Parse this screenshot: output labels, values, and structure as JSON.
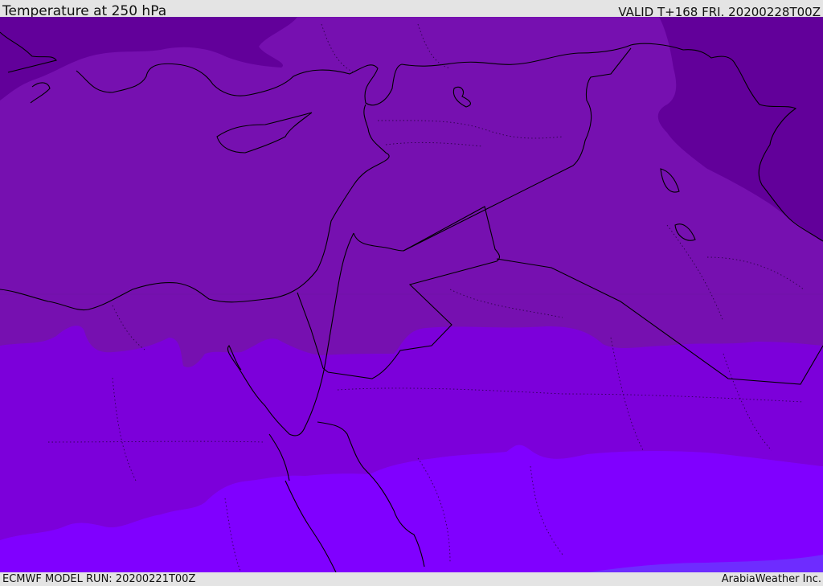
{
  "header": {
    "title": "Temperature at 250 hPa",
    "valid": "VALID T+168 FRI. 20200228T00Z"
  },
  "footer": {
    "model_run": "ECMWF MODEL RUN: 20200221T00Z",
    "brand": "ArabiaWeather Inc."
  },
  "colors": {
    "coldest": "#62009a",
    "cold": "#7610b0",
    "mid": "#7c00da",
    "warm": "#8000ff",
    "warm_alt": "#6e2cff",
    "coast": "#000000"
  }
}
